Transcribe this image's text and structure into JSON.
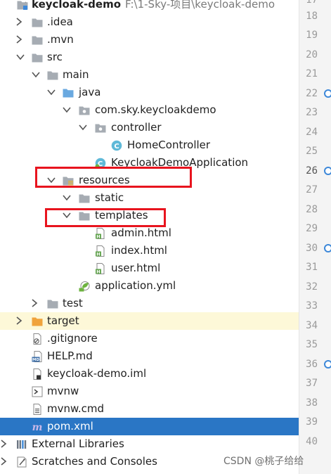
{
  "tree": [
    {
      "label": "keycloak-demo",
      "path": "F:\\1-Sky-项目\\keycloak-demo",
      "icon": "folder-module-icon",
      "expanded": true,
      "bold": true
    },
    {
      "label": ".idea",
      "icon": "folder-icon",
      "expanded": false
    },
    {
      "label": ".mvn",
      "icon": "folder-icon",
      "expanded": false
    },
    {
      "label": "src",
      "icon": "folder-icon",
      "expanded": true
    },
    {
      "label": "main",
      "icon": "folder-icon",
      "expanded": true
    },
    {
      "label": "java",
      "icon": "source-folder-icon",
      "expanded": true
    },
    {
      "label": "com.sky.keycloakdemo",
      "icon": "package-icon",
      "expanded": true
    },
    {
      "label": "controller",
      "icon": "package-icon",
      "expanded": true
    },
    {
      "label": "HomeController",
      "icon": "java-class-icon"
    },
    {
      "label": "KeycloakDemoApplication",
      "icon": "spring-boot-class-icon"
    },
    {
      "label": "resources",
      "icon": "resources-folder-icon",
      "expanded": true
    },
    {
      "label": "static",
      "icon": "folder-icon",
      "expanded": true
    },
    {
      "label": "templates",
      "icon": "folder-icon",
      "expanded": true
    },
    {
      "label": "admin.html",
      "icon": "html-file-icon"
    },
    {
      "label": "index.html",
      "icon": "html-file-icon"
    },
    {
      "label": "user.html",
      "icon": "html-file-icon"
    },
    {
      "label": "application.yml",
      "icon": "spring-yml-icon"
    },
    {
      "label": "test",
      "icon": "folder-icon",
      "expanded": false
    },
    {
      "label": "target",
      "icon": "excluded-folder-icon",
      "expanded": false
    },
    {
      "label": ".gitignore",
      "icon": "gitignore-file-icon"
    },
    {
      "label": "HELP.md",
      "icon": "markdown-file-icon"
    },
    {
      "label": "keycloak-demo.iml",
      "icon": "iml-file-icon"
    },
    {
      "label": "mvnw",
      "icon": "script-file-icon"
    },
    {
      "label": "mvnw.cmd",
      "icon": "text-file-icon"
    },
    {
      "label": "pom.xml",
      "icon": "maven-icon"
    },
    {
      "label": "External Libraries",
      "icon": "libraries-icon",
      "expanded": false
    },
    {
      "label": "Scratches and Consoles",
      "icon": "scratches-icon",
      "expanded": false
    }
  ],
  "line_numbers": [
    "17",
    "18",
    "19",
    "20",
    "21",
    "22",
    "23",
    "24",
    "25",
    "26",
    "27",
    "28",
    "29",
    "30",
    "31",
    "32",
    "33",
    "34",
    "35",
    "36",
    "37",
    "38",
    "39",
    "40"
  ],
  "gutter_markers": [
    "22",
    "26",
    "30",
    "36"
  ],
  "active_line": "26",
  "watermark": "CSDN @桃子给给",
  "colors": {
    "selection": "#2a76c5",
    "annotation_box": "#e8141e",
    "folder": "#a6acb3",
    "source_folder": "#6aa9e0",
    "excluded_folder": "#f0a33c",
    "gutter_marker": "#3d88d9"
  }
}
